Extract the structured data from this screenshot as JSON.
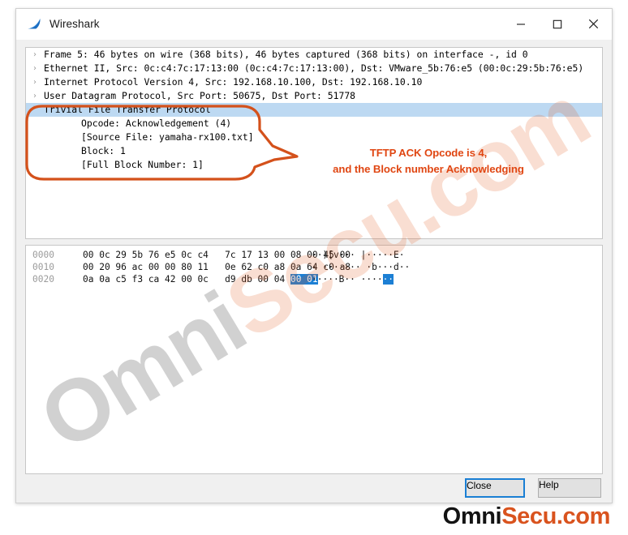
{
  "window": {
    "title": "Wireshark",
    "icon": "wireshark-shark-fin-icon",
    "controls": {
      "minimize": "minimize-icon",
      "maximize": "maximize-icon",
      "close": "close-icon"
    }
  },
  "detail_tree": [
    {
      "twisty": "›",
      "expanded": false,
      "selected": false,
      "indent": 0,
      "text": "Frame 5: 46 bytes on wire (368 bits), 46 bytes captured (368 bits) on interface -, id 0"
    },
    {
      "twisty": "›",
      "expanded": false,
      "selected": false,
      "indent": 0,
      "text": "Ethernet II, Src: 0c:c4:7c:17:13:00 (0c:c4:7c:17:13:00), Dst: VMware_5b:76:e5 (00:0c:29:5b:76:e5)"
    },
    {
      "twisty": "›",
      "expanded": false,
      "selected": false,
      "indent": 0,
      "text": "Internet Protocol Version 4, Src: 192.168.10.100, Dst: 192.168.10.10"
    },
    {
      "twisty": "›",
      "expanded": false,
      "selected": false,
      "indent": 0,
      "text": "User Datagram Protocol, Src Port: 50675, Dst Port: 51778"
    },
    {
      "twisty": "˅",
      "expanded": true,
      "selected": true,
      "indent": 0,
      "text": "Trivial File Transfer Protocol"
    },
    {
      "twisty": "",
      "expanded": false,
      "selected": false,
      "indent": 1,
      "text": "Opcode: Acknowledgement (4)"
    },
    {
      "twisty": "",
      "expanded": false,
      "selected": false,
      "indent": 1,
      "text": "[Source File: yamaha-rx100.txt]"
    },
    {
      "twisty": "",
      "expanded": false,
      "selected": false,
      "indent": 1,
      "text": "Block: 1"
    },
    {
      "twisty": "",
      "expanded": false,
      "selected": false,
      "indent": 1,
      "text": "[Full Block Number: 1]"
    }
  ],
  "hex_dump": [
    {
      "offset": "0000",
      "bytes_plain": "00 0c 29 5b 76 e5 0c c4   7c 17 13 00 08 00 45 00",
      "bytes_selected": "",
      "bytes_tail": "",
      "ascii_plain": "··)[v··· |·····E·",
      "ascii_selected": "",
      "ascii_tail": ""
    },
    {
      "offset": "0010",
      "bytes_plain": "00 20 96 ac 00 00 80 11   0e 62 c0 a8 0a 64 c0 a8",
      "bytes_selected": "",
      "bytes_tail": "",
      "ascii_plain": "· ······· ·b···d··",
      "ascii_selected": "",
      "ascii_tail": ""
    },
    {
      "offset": "0020",
      "bytes_plain": "0a 0a c5 f3 ca 42 00 0c   d9 db 00 04 ",
      "bytes_selected": "00 01",
      "bytes_tail": "",
      "ascii_plain": "·····B·· ····",
      "ascii_selected": "··",
      "ascii_tail": ""
    }
  ],
  "footer": {
    "close_label": "Close",
    "help_label": "Help"
  },
  "annotation": {
    "line1": "TFTP ACK Opcode is 4,",
    "line2": "and the Block number Acknowledging",
    "color": "#e04612"
  },
  "watermark": {
    "part1": "Omni",
    "part2": "Secu.com"
  },
  "brand": {
    "part1": "Omni",
    "part2": "Secu.com",
    "color1": "#131313",
    "color2": "#d9531e"
  }
}
